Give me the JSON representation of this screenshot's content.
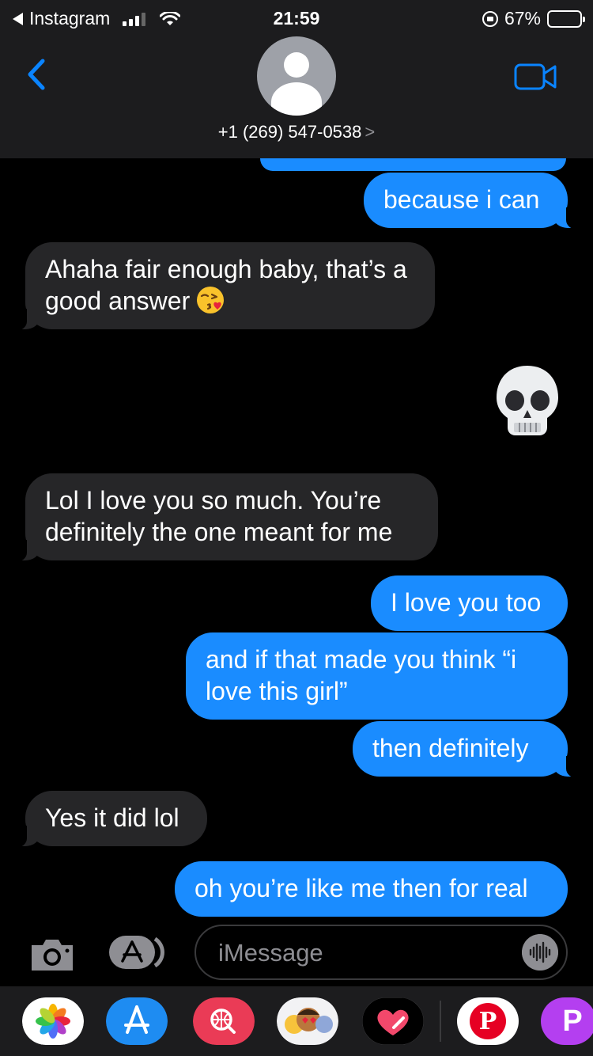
{
  "status_bar": {
    "back_app": "Instagram",
    "time": "21:59",
    "battery": "67%",
    "battery_level": 0.67
  },
  "header": {
    "contact": "+1 (269) 547-0538",
    "chevron": ">"
  },
  "messages": [
    {
      "from": "me",
      "text": "because i can"
    },
    {
      "from": "them",
      "text": "Ahaha fair enough baby, that’s a good answer",
      "emoji": "face-blowing-kiss"
    },
    {
      "from": "me",
      "emoji": "skull"
    },
    {
      "from": "them",
      "text": "Lol I love you so much. You’re definitely the one meant for me"
    },
    {
      "from": "me",
      "text": "I love you too"
    },
    {
      "from": "me",
      "text": "and if that made you think “i love this girl”"
    },
    {
      "from": "me",
      "text": "then definitely"
    },
    {
      "from": "them",
      "text": "Yes it did lol"
    },
    {
      "from": "me",
      "text": "oh you’re like me then for real"
    }
  ],
  "compose": {
    "placeholder": "iMessage"
  },
  "colors": {
    "outgoing_bubble": "#1a8cff",
    "incoming_bubble": "#262628",
    "accent": "#0a84ff"
  },
  "app_drawer": {
    "apps": [
      "photos-icon",
      "app-store-icon",
      "web-search-icon",
      "memoji-icon",
      "digital-touch-icon",
      "pinterest-icon",
      "picsart-icon"
    ],
    "pinterest_letter": "P",
    "picsart_letter": "P"
  }
}
